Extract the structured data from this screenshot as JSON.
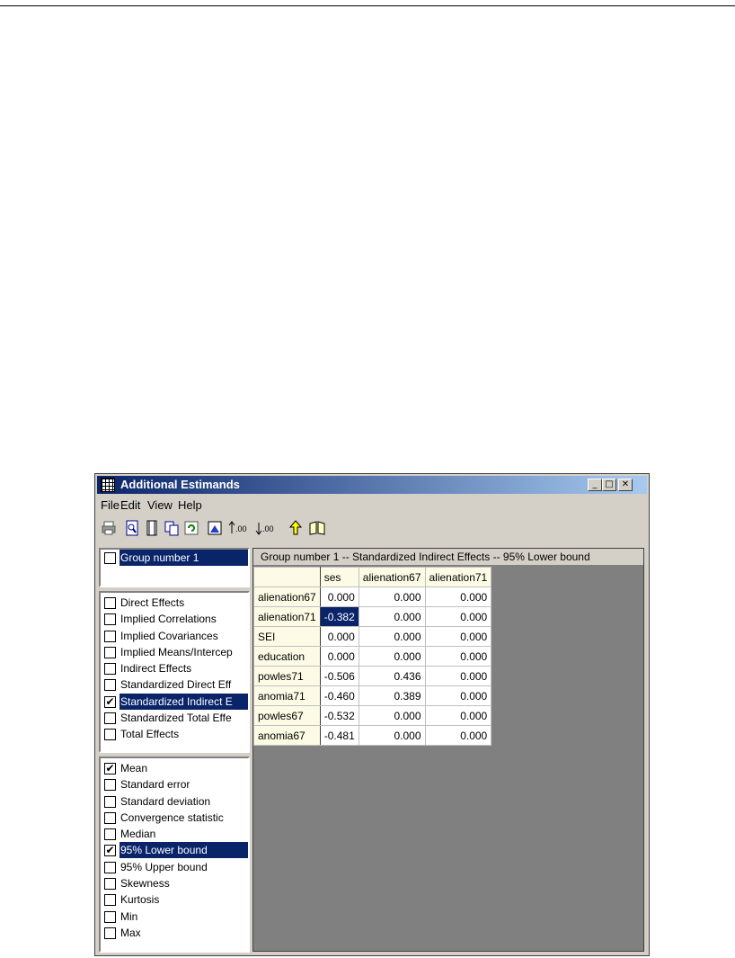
{
  "window": {
    "title": "Additional Estimands",
    "controls": {
      "minimize": "_",
      "maximize": "□",
      "close": "✕"
    }
  },
  "menu": [
    "File",
    "Edit",
    "View",
    "Help"
  ],
  "toolbar": {
    "icons": [
      "print-icon",
      "print-preview-icon",
      "page-setup-icon",
      "copy-icon",
      "refresh-icon",
      "view-chart-icon",
      "increase-decimals-icon",
      "decrease-decimals-icon",
      "up-arrow-icon",
      "help-book-icon"
    ],
    "increase_decimals": ".00",
    "decrease_decimals": ".00"
  },
  "groups": [
    {
      "label": "Group number 1",
      "checked": false,
      "selected": true
    }
  ],
  "estimands": [
    {
      "label": "Direct Effects",
      "checked": false,
      "selected": false
    },
    {
      "label": "Implied Correlations",
      "checked": false,
      "selected": false
    },
    {
      "label": "Implied Covariances",
      "checked": false,
      "selected": false
    },
    {
      "label": "Implied Means/Intercep",
      "checked": false,
      "selected": false
    },
    {
      "label": "Indirect Effects",
      "checked": false,
      "selected": false
    },
    {
      "label": "Standardized Direct Eff",
      "checked": false,
      "selected": false
    },
    {
      "label": "Standardized Indirect E",
      "checked": true,
      "selected": true
    },
    {
      "label": "Standardized Total Effe",
      "checked": false,
      "selected": false
    },
    {
      "label": "Total Effects",
      "checked": false,
      "selected": false
    }
  ],
  "statistics": [
    {
      "label": "Mean",
      "checked": true,
      "selected": false
    },
    {
      "label": "Standard error",
      "checked": false,
      "selected": false
    },
    {
      "label": "Standard deviation",
      "checked": false,
      "selected": false
    },
    {
      "label": "Convergence statistic",
      "checked": false,
      "selected": false
    },
    {
      "label": "Median",
      "checked": false,
      "selected": false
    },
    {
      "label": "95% Lower bound",
      "checked": true,
      "selected": true
    },
    {
      "label": "95% Upper bound",
      "checked": false,
      "selected": false
    },
    {
      "label": "Skewness",
      "checked": false,
      "selected": false
    },
    {
      "label": "Kurtosis",
      "checked": false,
      "selected": false
    },
    {
      "label": "Min",
      "checked": false,
      "selected": false
    },
    {
      "label": "Max",
      "checked": false,
      "selected": false
    }
  ],
  "table": {
    "header": "Group number 1 -- Standardized Indirect Effects -- 95% Lower bound",
    "columns": [
      "ses",
      "alienation67",
      "alienation71"
    ],
    "rows": [
      {
        "label": "alienation67",
        "values": [
          "0.000",
          "0.000",
          "0.000"
        ]
      },
      {
        "label": "alienation71",
        "values": [
          "-0.382",
          "0.000",
          "0.000"
        ]
      },
      {
        "label": "SEI",
        "values": [
          "0.000",
          "0.000",
          "0.000"
        ]
      },
      {
        "label": "education",
        "values": [
          "0.000",
          "0.000",
          "0.000"
        ]
      },
      {
        "label": "powles71",
        "values": [
          "-0.506",
          "0.436",
          "0.000"
        ]
      },
      {
        "label": "anomia71",
        "values": [
          "-0.460",
          "0.389",
          "0.000"
        ]
      },
      {
        "label": "powles67",
        "values": [
          "-0.532",
          "0.000",
          "0.000"
        ]
      },
      {
        "label": "anomia67",
        "values": [
          "-0.481",
          "0.000",
          "0.000"
        ]
      }
    ],
    "highlighted_cell": {
      "row": 1,
      "col": 0
    }
  },
  "colors": {
    "selection": "#0a246a",
    "title_gradient_start": "#0a246a",
    "title_gradient_end": "#a6caf0",
    "row_header_bg": "#fdfbe5",
    "viewer_bg": "#808080"
  }
}
